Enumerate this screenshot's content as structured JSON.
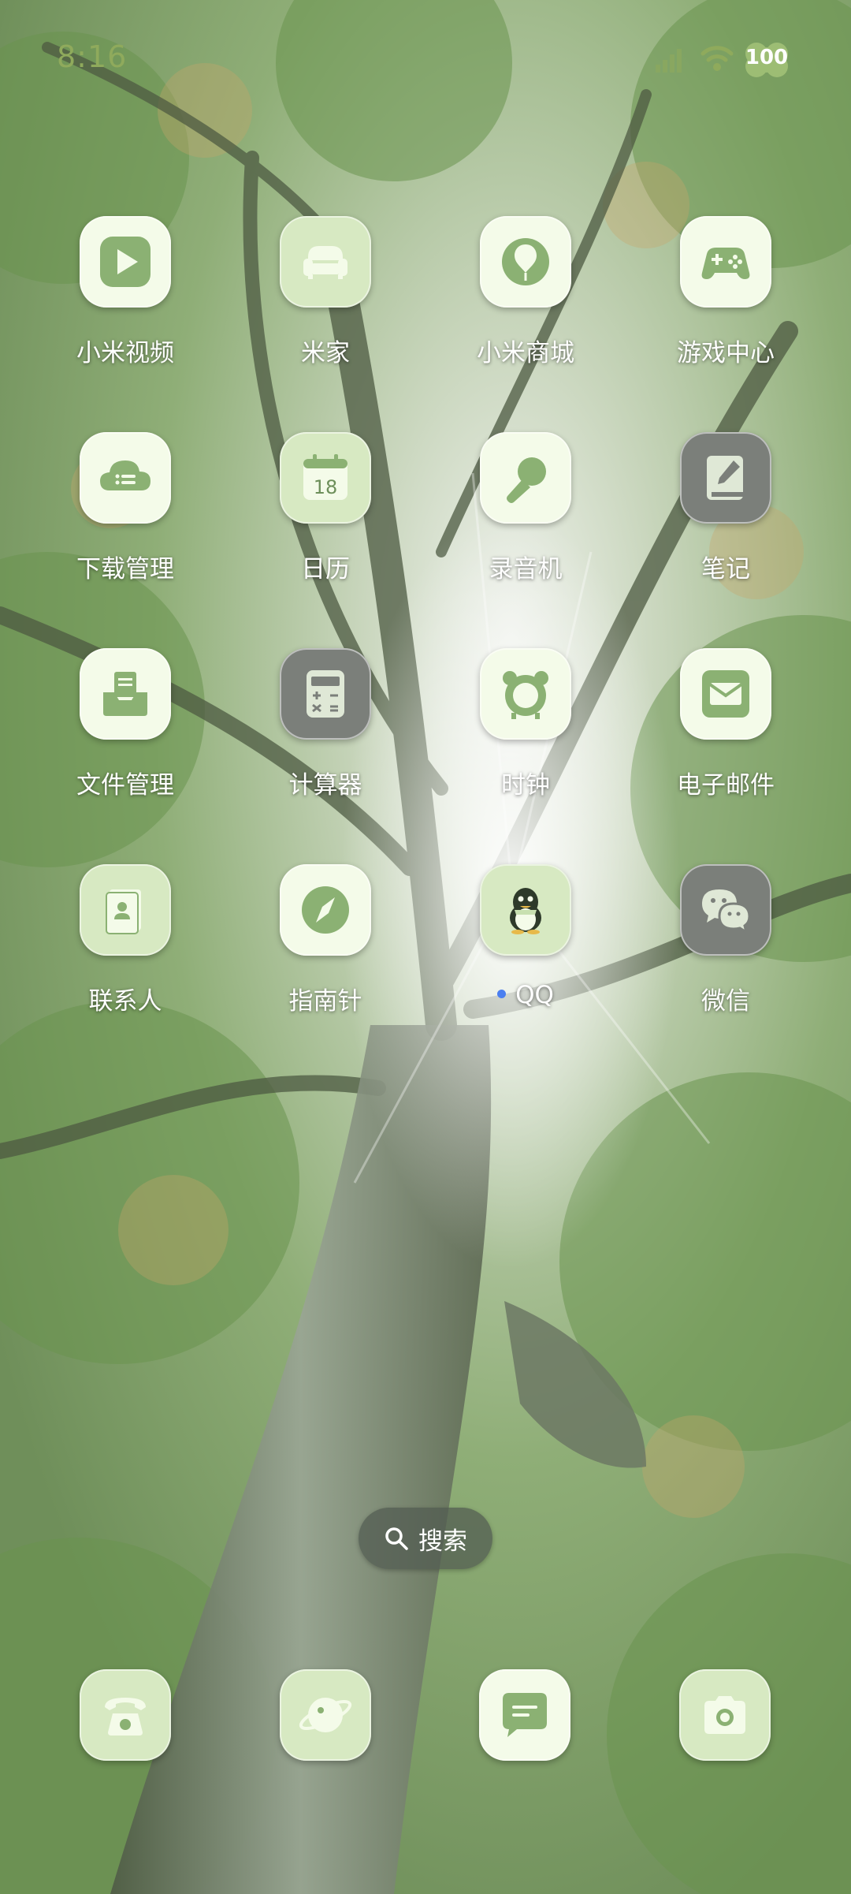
{
  "status_bar": {
    "time": "8:16",
    "battery": "100",
    "signal_icon": "signal-icon",
    "wifi_icon": "wifi-icon"
  },
  "apps": [
    {
      "label": "小米视频",
      "icon": "play-icon"
    },
    {
      "label": "米家",
      "icon": "sofa-icon"
    },
    {
      "label": "小米商城",
      "icon": "balloon-icon"
    },
    {
      "label": "游戏中心",
      "icon": "gamepad-icon"
    },
    {
      "label": "下载管理",
      "icon": "cloud-download-icon"
    },
    {
      "label": "日历",
      "icon": "calendar-icon",
      "day": "18"
    },
    {
      "label": "录音机",
      "icon": "microphone-icon"
    },
    {
      "label": "笔记",
      "icon": "notebook-icon"
    },
    {
      "label": "文件管理",
      "icon": "file-tray-icon"
    },
    {
      "label": "计算器",
      "icon": "calculator-icon"
    },
    {
      "label": "时钟",
      "icon": "alarm-clock-icon"
    },
    {
      "label": "电子邮件",
      "icon": "mail-icon"
    },
    {
      "label": "联系人",
      "icon": "contacts-icon"
    },
    {
      "label": "指南针",
      "icon": "compass-icon"
    },
    {
      "label": "QQ",
      "icon": "penguin-icon",
      "new_indicator": true
    },
    {
      "label": "微信",
      "icon": "chat-bubbles-icon"
    }
  ],
  "search": {
    "label": "搜索",
    "icon": "search-icon"
  },
  "dock": [
    {
      "icon": "phone-icon"
    },
    {
      "icon": "planet-icon"
    },
    {
      "icon": "message-icon"
    },
    {
      "icon": "camera-icon"
    }
  ],
  "theme": {
    "icon_tint": "#7da36a",
    "tile_light": "#f4fbe9",
    "tile_mid": "#d7e9c2",
    "tile_dark": "#7b7f7a",
    "badge_dot": "#4b7ff0"
  }
}
